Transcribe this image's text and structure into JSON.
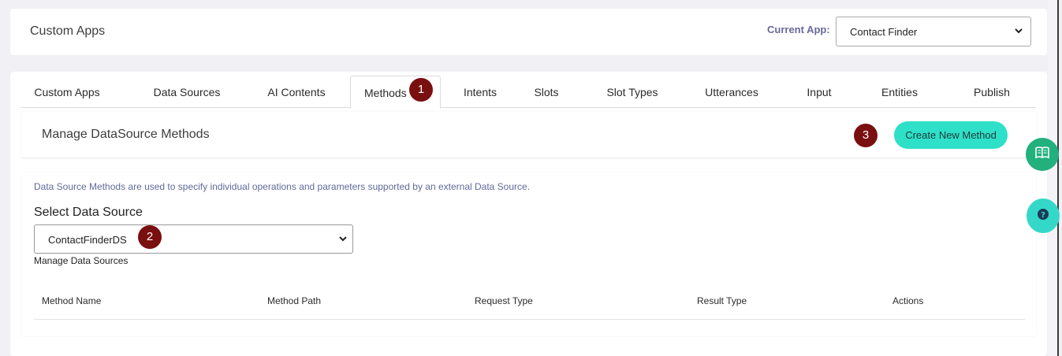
{
  "header": {
    "title": "Custom Apps",
    "current_app_label": "Current App:",
    "current_app_value": "Contact Finder"
  },
  "tabs": [
    {
      "label": "Custom Apps"
    },
    {
      "label": "Data Sources"
    },
    {
      "label": "AI Contents"
    },
    {
      "label": "Methods",
      "active": true
    },
    {
      "label": "Intents"
    },
    {
      "label": "Slots"
    },
    {
      "label": "Slot Types"
    },
    {
      "label": "Utterances"
    },
    {
      "label": "Input"
    },
    {
      "label": "Entities"
    },
    {
      "label": "Publish"
    }
  ],
  "badges": [
    "1",
    "2",
    "3"
  ],
  "section": {
    "title": "Manage DataSource Methods",
    "create_button": "Create New Method"
  },
  "content": {
    "description": "Data Source Methods are used to specify individual operations and parameters supported by an external Data Source.",
    "select_label": "Select Data Source",
    "selected_data_source": "ContactFinderDS",
    "manage_link": "Manage Data Sources"
  },
  "table": {
    "columns": [
      "Method Name",
      "Method Path",
      "Request Type",
      "Result Type",
      "Actions"
    ],
    "rows": []
  },
  "floating": {
    "guide_icon": "book-icon",
    "help_icon": "question-icon"
  },
  "colors": {
    "accent": "#2ee0c8",
    "badge": "#7a0f0f",
    "guide_button": "#22b07d",
    "help_button": "#34d8c8",
    "description_text": "#5f6b9a"
  }
}
